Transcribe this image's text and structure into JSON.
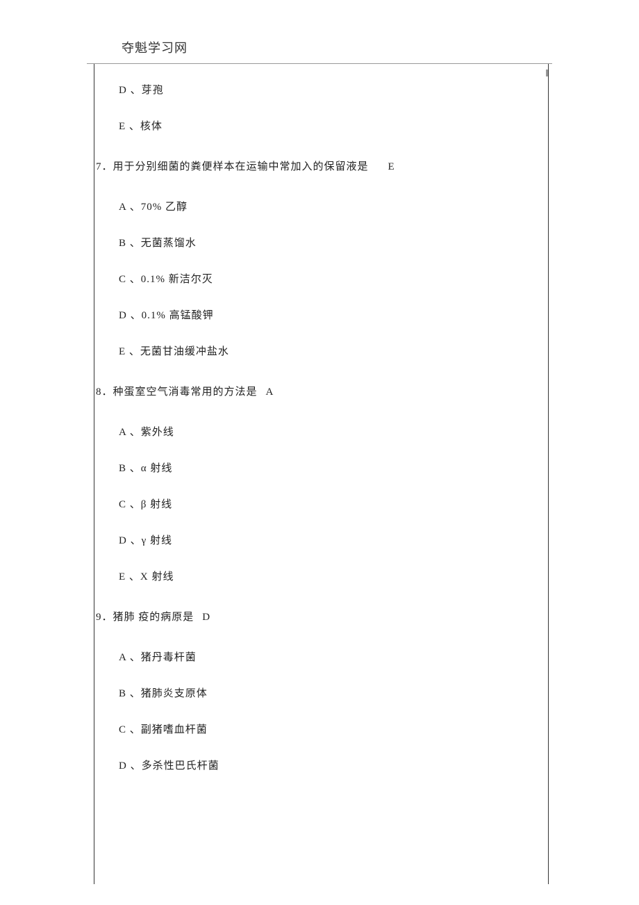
{
  "header_faint": "",
  "site_title": "夺魁学习网",
  "questions": [
    {
      "leading_options": [
        "D 、芽孢",
        "E 、核体"
      ]
    },
    {
      "number": "7．",
      "stem": "用于分别细菌的粪便样本在运输中常加入的保留液是",
      "answer": "E",
      "answer_class": "answer-suffix",
      "options": [
        "A 、70% 乙醇",
        "B 、无菌蒸馏水",
        "C 、0.1% 新洁尔灭",
        "D 、0.1% 高锰酸钾",
        "E 、无菌甘油缓冲盐水"
      ]
    },
    {
      "number": "8．",
      "stem": "种蛋室空气消毒常用的方法是",
      "answer": "A",
      "answer_class": "answer-suffix-short",
      "options": [
        "A 、紫外线",
        "B 、α 射线",
        "C 、β 射线",
        "D 、γ 射线",
        "E 、X 射线"
      ]
    },
    {
      "number": "9．",
      "stem": "猪肺 疫的病原是",
      "answer": "D",
      "answer_class": "answer-suffix-short",
      "options": [
        "A 、猪丹毒杆菌",
        "B 、猪肺炎支原体",
        "C 、副猪嗜血杆菌",
        "D 、多杀性巴氏杆菌"
      ]
    }
  ]
}
